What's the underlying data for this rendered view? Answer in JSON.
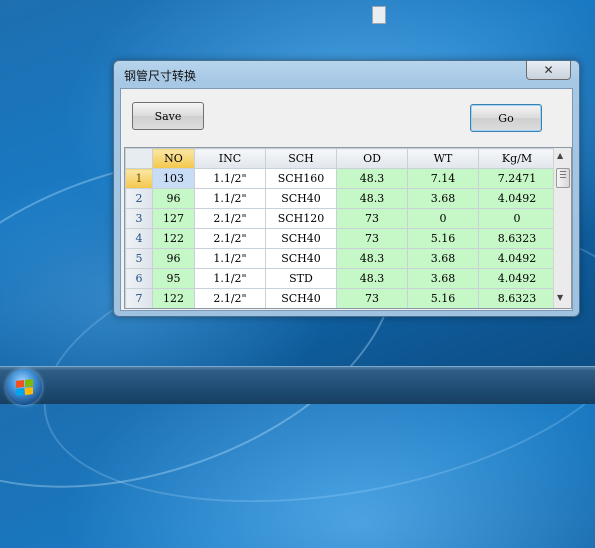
{
  "window": {
    "title": "钢管尺寸转换",
    "close_glyph": "✕",
    "save_label": "Save",
    "go_label": "Go"
  },
  "grid": {
    "columns": [
      "NO",
      "INC",
      "SCH",
      "OD",
      "WT",
      "Kg/M"
    ],
    "rows": [
      {
        "n": "1",
        "cells": [
          "103",
          "1.1/2\"",
          "SCH160",
          "48.3",
          "7.14",
          "7.2471"
        ]
      },
      {
        "n": "2",
        "cells": [
          "96",
          "1.1/2\"",
          "SCH40",
          "48.3",
          "3.68",
          "4.0492"
        ]
      },
      {
        "n": "3",
        "cells": [
          "127",
          "2.1/2\"",
          "SCH120",
          "73",
          "0",
          "0"
        ]
      },
      {
        "n": "4",
        "cells": [
          "122",
          "2.1/2\"",
          "SCH40",
          "73",
          "5.16",
          "8.6323"
        ]
      },
      {
        "n": "5",
        "cells": [
          "96",
          "1.1/2\"",
          "SCH40",
          "48.3",
          "3.68",
          "4.0492"
        ]
      },
      {
        "n": "6",
        "cells": [
          "95",
          "1.1/2\"",
          "STD",
          "48.3",
          "3.68",
          "4.0492"
        ]
      },
      {
        "n": "7",
        "cells": [
          "122",
          "2.1/2\"",
          "SCH40",
          "73",
          "5.16",
          "8.6323"
        ]
      }
    ]
  },
  "colors": {
    "editable": "#c6f7c6",
    "selected_header": "#f2c74a",
    "current_cell": "#c9dcf5"
  },
  "icons": [
    "windows-start-icon",
    "close-icon",
    "scroll-up-icon",
    "scroll-down-icon"
  ]
}
